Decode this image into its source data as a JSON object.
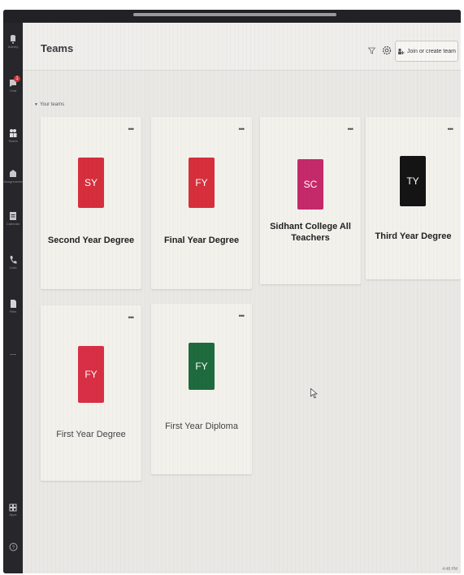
{
  "header": {
    "title": "Teams",
    "join_label": "Join or create team"
  },
  "section": {
    "label": "Your teams"
  },
  "rail": {
    "items": [
      {
        "icon": "activity-icon",
        "label": "Activity"
      },
      {
        "icon": "chat-icon",
        "label": "Chat",
        "badge": "1"
      },
      {
        "icon": "teams-icon",
        "label": "Teams"
      },
      {
        "icon": "assignments-icon",
        "label": "Assignments"
      },
      {
        "icon": "calendar-icon",
        "label": "Calendar"
      },
      {
        "icon": "calls-icon",
        "label": "Calls"
      },
      {
        "icon": "files-icon",
        "label": "Files"
      },
      {
        "icon": "more-icon",
        "label": "..."
      }
    ],
    "apps_label": "Apps",
    "help_icon": "help-icon"
  },
  "teams": [
    {
      "initials": "SY",
      "name": "Second Year Degree",
      "color": "#d62e3c"
    },
    {
      "initials": "FY",
      "name": "Final Year Degree",
      "color": "#d72f3c"
    },
    {
      "initials": "SC",
      "name": "Sidhant College All Teachers",
      "color": "#c42a6a"
    },
    {
      "initials": "TY",
      "name": "Third Year Degree",
      "color": "#141414"
    },
    {
      "initials": "FY",
      "name": "First Year Degree",
      "color": "#d92f45"
    },
    {
      "initials": "FY",
      "name": "First Year Diploma",
      "color": "#1e6b3e"
    }
  ],
  "more_label": "•••",
  "corner": "4:48 PM"
}
